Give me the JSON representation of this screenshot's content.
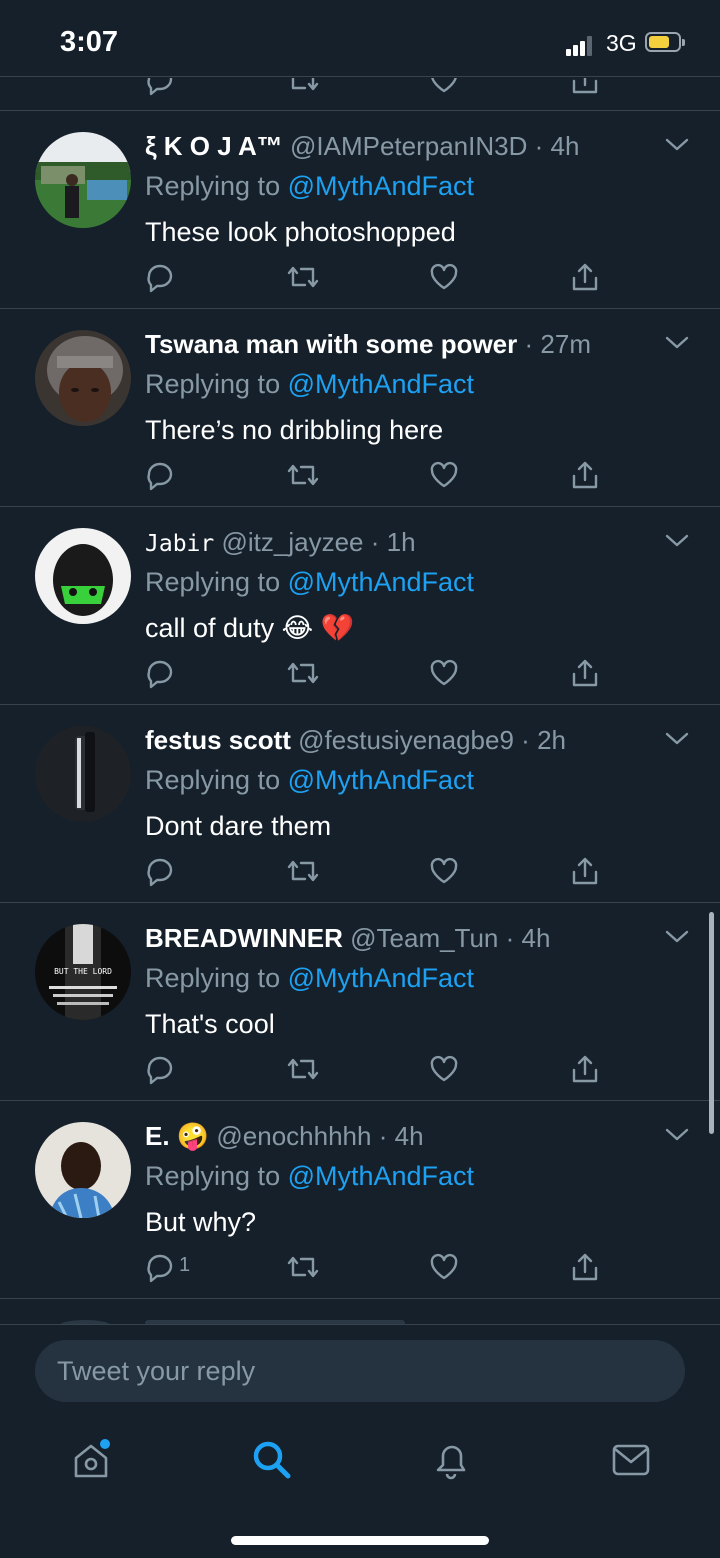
{
  "status_bar": {
    "time": "3:07",
    "network": "3G",
    "battery_level": 0.62
  },
  "tweets": [
    {
      "name": "ξ K O J A™",
      "handle": "@IAMPeterpanIN3D",
      "sep": "·",
      "time": "4h",
      "reply_prefix": "Replying to ",
      "reply_to": "@MythAndFact",
      "text": "These look photoshopped",
      "reply_count": ""
    },
    {
      "name": "Tswana man with some power",
      "handle": "",
      "sep": "·",
      "time": "27m",
      "reply_prefix": "Replying to ",
      "reply_to": "@MythAndFact",
      "text": "There’s no dribbling here",
      "reply_count": ""
    },
    {
      "name": "Jabir",
      "handle": "@itz_jayzee",
      "sep": "·",
      "time": "1h",
      "reply_prefix": "Replying to ",
      "reply_to": "@MythAndFact",
      "text": "call of duty 😂 💔",
      "reply_count": ""
    },
    {
      "name": "festus scott",
      "handle": "@festusiyenagbe9",
      "sep": "·",
      "time": "2h",
      "reply_prefix": "Replying to ",
      "reply_to": "@MythAndFact",
      "text": "Dont dare them",
      "reply_count": ""
    },
    {
      "name": "BREADWINNER",
      "handle": "@Team_Tun",
      "sep": "·",
      "time": "4h",
      "reply_prefix": "Replying to ",
      "reply_to": "@MythAndFact",
      "text": "That's cool",
      "reply_count": ""
    },
    {
      "name": "E. 🤪",
      "handle": "@enochhhhh",
      "sep": "·",
      "time": "4h",
      "reply_prefix": "Replying to ",
      "reply_to": "@MythAndFact",
      "text": "But why?",
      "reply_count": "1"
    }
  ],
  "avatar_labels": {
    "breadwinner": "BUT THE LORD"
  },
  "composer": {
    "placeholder": "Tweet your reply"
  },
  "tabs": [
    {
      "icon": "home-icon",
      "has_notification_dot": true
    },
    {
      "icon": "search-icon",
      "active": true
    },
    {
      "icon": "bell-icon"
    },
    {
      "icon": "mail-icon"
    }
  ],
  "colors": {
    "background": "#15202b",
    "accent": "#1da1f2",
    "secondary_text": "#8899a6",
    "divider": "#38444d"
  }
}
